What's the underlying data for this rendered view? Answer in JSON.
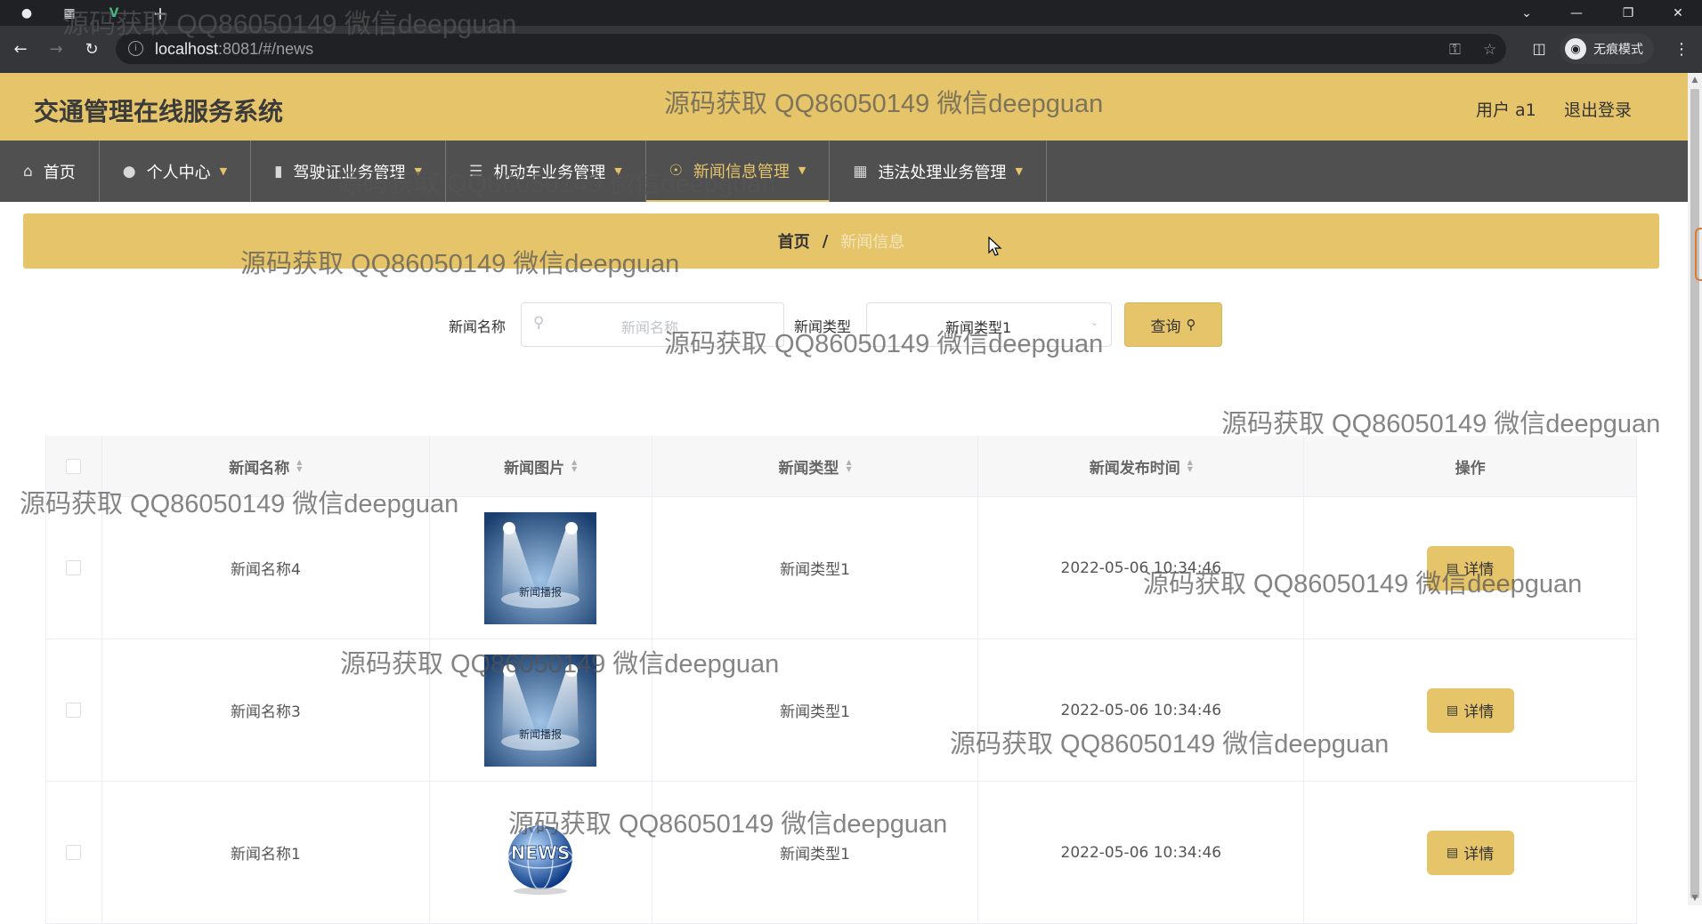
{
  "browser": {
    "url_host": "localhost",
    "url_rest": ":8081/#/news",
    "incognito_label": "无痕模式"
  },
  "header": {
    "title": "交通管理在线服务系统",
    "user": "用户 a1",
    "logout": "退出登录"
  },
  "menu": [
    {
      "label": "首页",
      "icon": "home-icon"
    },
    {
      "label": "个人中心",
      "icon": "user-icon"
    },
    {
      "label": "驾驶证业务管理",
      "icon": "mic-icon"
    },
    {
      "label": "机动车业务管理",
      "icon": "list-icon"
    },
    {
      "label": "新闻信息管理",
      "icon": "compass-icon"
    },
    {
      "label": "违法处理业务管理",
      "icon": "grid-icon"
    }
  ],
  "breadcrumb": {
    "home": "首页",
    "sep": "/",
    "current": "新闻信息"
  },
  "search": {
    "name_label": "新闻名称",
    "name_placeholder": "新闻名称",
    "type_label": "新闻类型",
    "type_value": "新闻类型1",
    "button": "查询"
  },
  "table": {
    "headers": [
      "新闻名称",
      "新闻图片",
      "新闻类型",
      "新闻发布时间",
      "操作"
    ],
    "rows": [
      {
        "name": "新闻名称4",
        "image": "新闻播报",
        "type": "新闻类型1",
        "time": "2022-05-06 10:34:46",
        "action": "详情"
      },
      {
        "name": "新闻名称3",
        "image": "新闻播报",
        "type": "新闻类型1",
        "time": "2022-05-06 10:34:46",
        "action": "详情"
      },
      {
        "name": "新闻名称1",
        "image": "NEWS",
        "type": "新闻类型1",
        "time": "2022-05-06 10:34:46",
        "action": "详情"
      }
    ]
  },
  "watermark": "源码获取 QQ86050149 微信deepguan",
  "colors": {
    "accent": "#e6c46a",
    "menu_bg": "#505050",
    "chrome_bg": "#202124"
  }
}
